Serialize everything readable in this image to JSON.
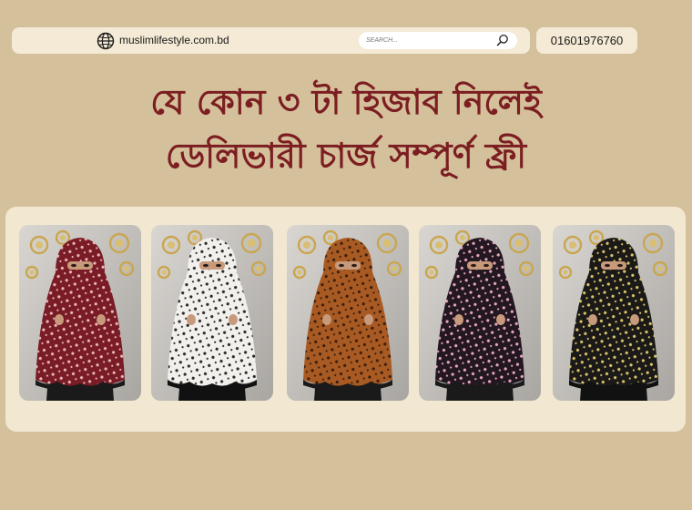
{
  "header": {
    "site_url": "muslimlifestyle.com.bd",
    "search_placeholder": "SEARCH...",
    "phone": "01601976760",
    "icons": {
      "site": "globe-icon",
      "search": "search-icon"
    }
  },
  "promo": {
    "line1": "যে কোন ৩ টা হিজাব নিলেই",
    "line2": "ডেলিভারী চার্জ সম্পূর্ণ ফ্রী"
  },
  "colors": {
    "background": "#d4c09a",
    "bar": "#f4ead5",
    "headline": "#7c1d22",
    "panel": "#f2e7d0"
  },
  "products": [
    {
      "hijab_color": "#7a1c26",
      "pattern_color": "#e8b6b6",
      "trim_color": "#1a1a1a"
    },
    {
      "hijab_color": "#f2f0ec",
      "pattern_color": "#2a2a2a",
      "trim_color": "#111111"
    },
    {
      "hijab_color": "#a85a22",
      "pattern_color": "#3a1e10",
      "trim_color": "#1a1a1a"
    },
    {
      "hijab_color": "#231822",
      "pattern_color": "#e7a7b8",
      "trim_color": "#1a1a1a"
    },
    {
      "hijab_color": "#1b1a18",
      "pattern_color": "#d9c46a",
      "trim_color": "#111111"
    }
  ]
}
